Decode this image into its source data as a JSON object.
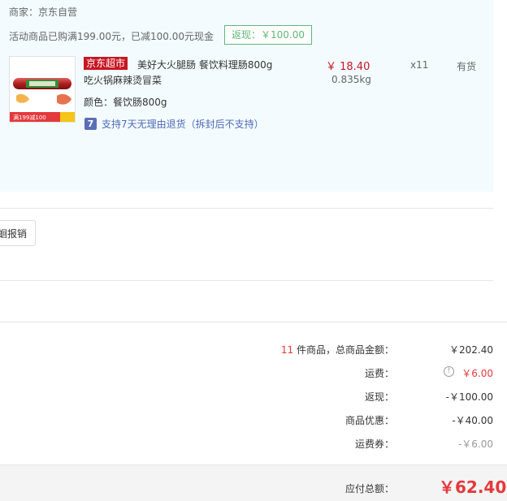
{
  "order": {
    "merchant_label": "商家：京东自营",
    "promo_text": "活动商品已购满199.00元，已减100.00元现金",
    "promo_tag": "返现：￥100.00",
    "item": {
      "store_tag": "京东超市",
      "name_line1": "美好大火腿肠 餐饮料理肠800g",
      "name_line2": "吃火锅麻辣烫冒菜",
      "color": "颜色：餐饮肠800g",
      "return_icon_text": "7",
      "return_policy": "支持7天无理由退货（拆封后不支持）",
      "price": "￥ 18.40",
      "weight": "0.835kg",
      "quantity": "x11",
      "stock": "有货",
      "thumb_banner": "满199减100"
    }
  },
  "invoice": {
    "button_label": "蛔报销"
  },
  "summary": {
    "count": "11",
    "count_suffix": " 件商品，总商品金额：",
    "total_value": "￥202.40",
    "shipping_label": "运费：",
    "shipping_value": "￥6.00",
    "cashback_label": "返现：",
    "cashback_value": "-￥100.00",
    "discount_label": "商品优惠：",
    "discount_value": "-￥40.00",
    "coupon_label": "运费券：",
    "coupon_value": "-￥6.00"
  },
  "footer": {
    "payable_label": "应付总额：",
    "payable_value": "￥62.40"
  },
  "colors": {
    "accent_red": "#e4393c",
    "jd_red": "#c81623",
    "promo_green": "#5fb878",
    "link_blue": "#4f6ab6",
    "panel_bg": "#f3fbfe"
  }
}
